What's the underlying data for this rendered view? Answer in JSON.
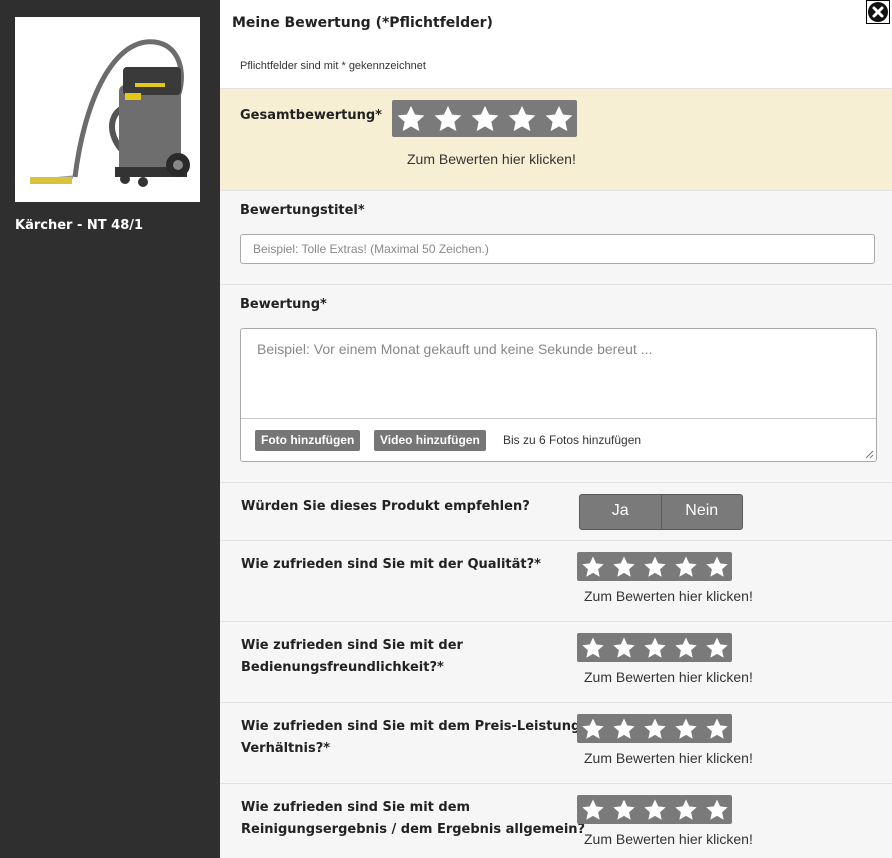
{
  "product": {
    "name": "Kärcher - NT 48/1"
  },
  "header": {
    "title": "Meine Bewertung (*Pflichtfelder)",
    "note": "Pflichtfelder sind mit * gekennzeichnet"
  },
  "overall": {
    "label": "Gesamtbewertung*",
    "hint": "Zum Bewerten hier klicken!",
    "rating": 0,
    "max": 5
  },
  "title_field": {
    "label": "Bewertungstitel*",
    "placeholder": "Beispiel: Tolle Extras! (Maximal 50 Zeichen.)"
  },
  "review_field": {
    "label": "Bewertung*",
    "placeholder": "Beispiel: Vor einem Monat gekauft und keine Sekunde bereut ...",
    "add_photo": "Foto hinzufügen",
    "add_video": "Video hinzufügen",
    "photo_note": "Bis zu 6 Fotos hinzufügen"
  },
  "recommend": {
    "label": "Würden Sie dieses Produkt empfehlen?",
    "yes": "Ja",
    "no": "Nein"
  },
  "questions": [
    {
      "line1": "Wie zufrieden sind Sie mit der Qualität?*",
      "line2": "",
      "hint": "Zum Bewerten hier klicken!"
    },
    {
      "line1": "Wie zufrieden sind Sie mit der",
      "line2": "Bedienungsfreundlichkeit?*",
      "hint": "Zum Bewerten hier klicken!"
    },
    {
      "line1": "Wie zufrieden sind Sie mit dem Preis-Leistungs-",
      "line2": "Verhältnis?*",
      "hint": "Zum Bewerten hier klicken!"
    },
    {
      "line1": "Wie zufrieden sind Sie mit dem",
      "line2": "Reinigungsergebnis / dem Ergebnis allgemein?",
      "hint": "Zum Bewerten hier klicken!"
    }
  ],
  "colors": {
    "sidebar": "#2f2f2f",
    "overall_bg": "#f7efd3",
    "section_bg": "#f6f6f6",
    "star_bg": "#7a7a7a"
  },
  "icons": {
    "close": "close-circle-icon",
    "star": "star-icon"
  }
}
